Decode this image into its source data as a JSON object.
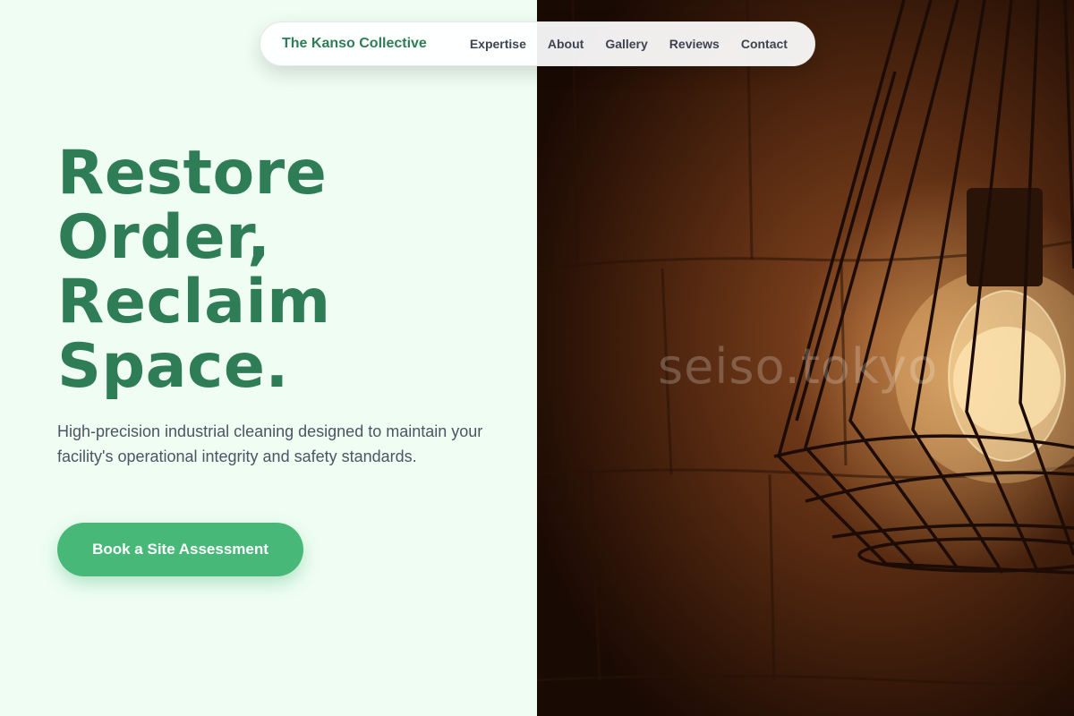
{
  "nav": {
    "brand": "The Kanso Collective",
    "links": [
      "Expertise",
      "About",
      "Gallery",
      "Reviews",
      "Contact"
    ]
  },
  "hero": {
    "title_lines": [
      "Restore",
      "Order,",
      "Reclaim",
      "Space."
    ],
    "subtitle": "High-precision industrial cleaning designed to maintain your facility's operational integrity and safety standards.",
    "cta_label": "Book a Site Assessment",
    "image_watermark": "seiso.tokyo"
  },
  "colors": {
    "background": "#effdf3",
    "brand_green": "#2f7d57",
    "cta_green": "#47b877",
    "body_text": "#4b5563"
  }
}
